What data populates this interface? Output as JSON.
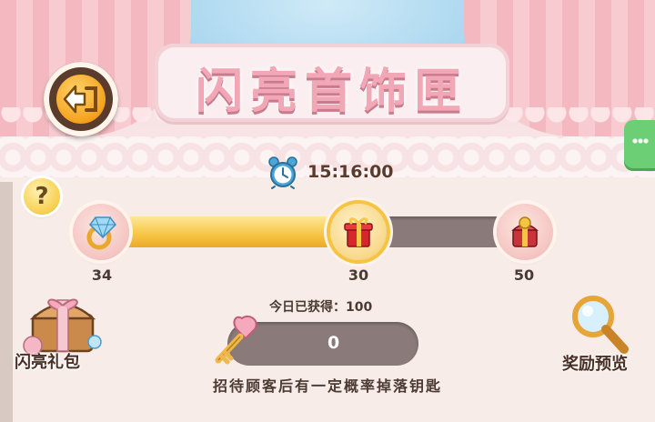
{
  "title": "闪亮首饰匣",
  "timer": {
    "text": "15:16:00"
  },
  "progress": {
    "fill_fraction": 0.55,
    "nodes": [
      {
        "icon": "ring-icon",
        "label": "34"
      },
      {
        "icon": "gift-box-icon",
        "label": "30"
      },
      {
        "icon": "treasure-box-icon",
        "label": "50"
      }
    ]
  },
  "today": {
    "text": "今日已获得：100"
  },
  "key_count": "0",
  "hint": "招待顾客后有一定概率掉落钥匙",
  "gift_pack": {
    "label": "闪亮礼包"
  },
  "reward_preview": {
    "label": "奖励预览"
  },
  "help": {
    "symbol": "?"
  },
  "colors": {
    "fill": "#f6c443",
    "track": "#8a7a7a",
    "title": "#f1a7b6"
  }
}
